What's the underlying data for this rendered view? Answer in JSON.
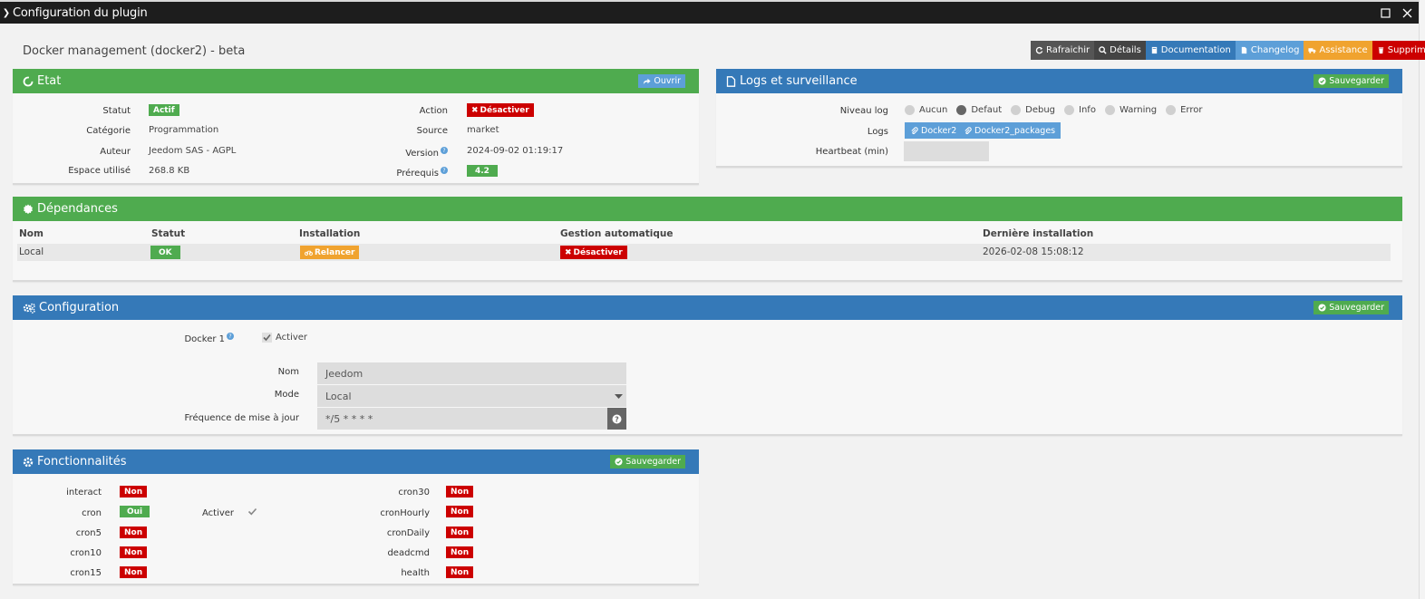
{
  "window": {
    "title": "Configuration du plugin"
  },
  "plugin": {
    "name": "Docker management (docker2) - beta"
  },
  "toolbar": {
    "buttons": [
      {
        "label": "Rafraichir",
        "color": "#555555"
      },
      {
        "label": "Détails",
        "color": "#444444"
      },
      {
        "label": "Documentation",
        "color": "#3579b8"
      },
      {
        "label": "Changelog",
        "color": "#5d9fd8"
      },
      {
        "label": "Assistance",
        "color": "#f0a32f"
      },
      {
        "label": "Supprimer",
        "color": "#cc0000"
      }
    ]
  },
  "etat": {
    "title": "Etat",
    "open_button": "Ouvrir",
    "statut_label": "Statut",
    "statut_value": "Actif",
    "categorie_label": "Catégorie",
    "categorie_value": "Programmation",
    "auteur_label": "Auteur",
    "auteur_value": "Jeedom SAS - AGPL",
    "espace_label": "Espace utilisé",
    "espace_value": "268.8 KB",
    "action_label": "Action",
    "action_value": "Désactiver",
    "source_label": "Source",
    "source_value": "market",
    "version_label": "Version",
    "version_value": "2024-09-02 01:19:17",
    "prerequis_label": "Prérequis",
    "prerequis_value": "4.2"
  },
  "logs": {
    "title": "Logs et surveillance",
    "save_button": "Sauvegarder",
    "niveau_label": "Niveau log",
    "levels": [
      "Aucun",
      "Defaut",
      "Debug",
      "Info",
      "Warning",
      "Error"
    ],
    "selected_level": "Defaut",
    "logs_label": "Logs",
    "log_buttons": [
      "Docker2",
      "Docker2_packages"
    ],
    "heartbeat_label": "Heartbeat (min)",
    "heartbeat_value": ""
  },
  "dependances": {
    "title": "Dépendances",
    "headers": [
      "Nom",
      "Statut",
      "Installation",
      "Gestion automatique",
      "Dernière installation"
    ],
    "row": {
      "nom": "Local",
      "statut": "OK",
      "installation": "Relancer",
      "gestion": "Désactiver",
      "derniere": "2026-02-08 15:08:12"
    }
  },
  "configuration": {
    "title": "Configuration",
    "save_button": "Sauvegarder",
    "docker1_label": "Docker 1",
    "activer_label": "Activer",
    "activer_checked": true,
    "nom_label": "Nom",
    "nom_value": "Jeedom",
    "mode_label": "Mode",
    "mode_value": "Local",
    "frequence_label": "Fréquence de mise à jour",
    "frequence_value": "*/5 * * * *"
  },
  "fonctionnalites": {
    "title": "Fonctionnalités",
    "save_button": "Sauvegarder",
    "left": [
      {
        "name": "interact",
        "value": "Non"
      },
      {
        "name": "cron",
        "value": "Oui"
      },
      {
        "name": "cron5",
        "value": "Non"
      },
      {
        "name": "cron10",
        "value": "Non"
      },
      {
        "name": "cron15",
        "value": "Non"
      }
    ],
    "right": [
      {
        "name": "cron30",
        "value": "Non"
      },
      {
        "name": "cronHourly",
        "value": "Non"
      },
      {
        "name": "cronDaily",
        "value": "Non"
      },
      {
        "name": "deadcmd",
        "value": "Non"
      },
      {
        "name": "health",
        "value": "Non"
      }
    ],
    "cron_activer_label": "Activer",
    "cron_activer_checked": true
  }
}
